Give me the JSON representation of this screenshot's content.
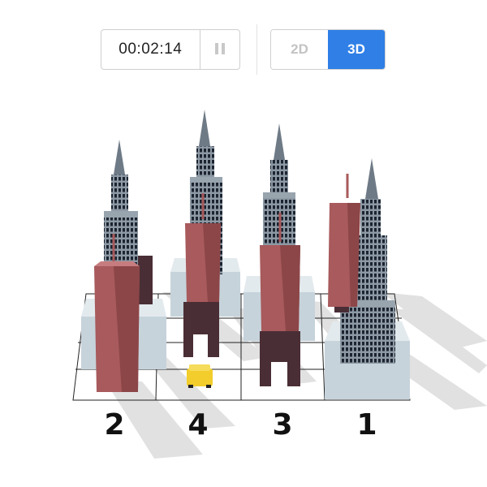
{
  "toolbar": {
    "timer": "00:02:14",
    "pause_icon": "pause-icon",
    "mode_2d_label": "2D",
    "mode_3d_label": "3D",
    "active_mode": "3D",
    "accent_color": "#2f7fe6"
  },
  "puzzle": {
    "bottom_clues": [
      "2",
      "4",
      "3",
      "1"
    ],
    "colors": {
      "gray_building": "#6e7a86",
      "red_building": "#a85a5c",
      "dark_building": "#4a2e35",
      "podium": "#c6d3db",
      "taxi": "#f2cd2c"
    }
  }
}
